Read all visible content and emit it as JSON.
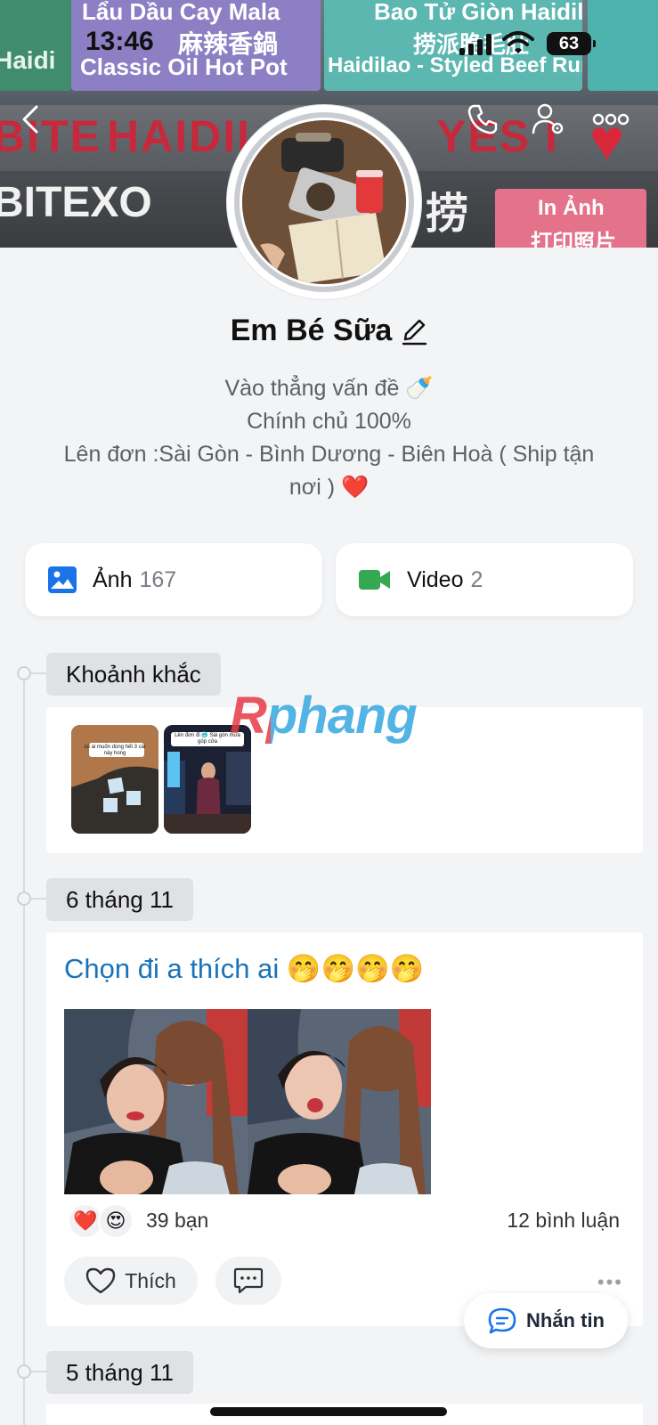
{
  "status_bar": {
    "time": "13:46",
    "battery": "63"
  },
  "cover_signs": {
    "top_left": "Haidi",
    "top_mid_line1": "Lẩu Dầu Cay Mala",
    "top_mid_line2": "麻辣香鍋",
    "top_mid_line3": "Classic Oil Hot Pot",
    "top_right_line1": "Bao Tử Giòn Haidilao",
    "top_right_line2": "捞派脆毛肚",
    "top_right_line3": "Haidilao - Styled Beef Rumen",
    "red_text_1": "BITE",
    "red_text_2": "HAIDILAO",
    "red_text_3": "YES I",
    "white_text_1": "BITEXO",
    "white_text_2": "捞",
    "pink_sign_line1": "In Ảnh",
    "pink_sign_line2": "打印照片"
  },
  "profile": {
    "name": "Em Bé Sữa",
    "bio_lines": [
      "Vào thẳng vấn đề 🍼",
      "Chính chủ 100%",
      "Lên đơn :Sài Gòn - Bình Dương - Biên Hoà  ( Ship tận",
      "nơi ) ❤️"
    ]
  },
  "media": {
    "photos_label": "Ảnh",
    "photos_count": "167",
    "videos_label": "Video",
    "videos_count": "2"
  },
  "timeline": {
    "moments_label": "Khoảnh khắc",
    "moment_1_caption": "có ai muốn dùng hết 3 cái này hong",
    "moment_2_caption": "Lên đơn đi 🥶 Sài gòn mưa góp cửa",
    "date_1": "6 tháng 11",
    "date_2": "5 tháng 11"
  },
  "post": {
    "text": "Chọn đi a thích ai 🤭🤭🤭🤭",
    "reaction_1": "❤️",
    "reaction_2": "😍",
    "reaction_count": "39 bạn",
    "comments_count": "12 bình luận",
    "like_label": "Thích",
    "more": "•••"
  },
  "fab": {
    "message_label": "Nhắn tin"
  },
  "watermark": "Rphang",
  "colors": {
    "accent_blue": "#1a73b8",
    "photo_icon": "#1a73e8",
    "video_icon": "#34a853",
    "background": "#f3f4f6"
  },
  "icons": [
    "back-icon",
    "phone-icon",
    "person-settings-icon",
    "more-icon",
    "edit-pencil-icon",
    "photo-icon",
    "video-camera-icon",
    "heart-outline-icon",
    "comment-icon",
    "message-bubble-icon"
  ]
}
